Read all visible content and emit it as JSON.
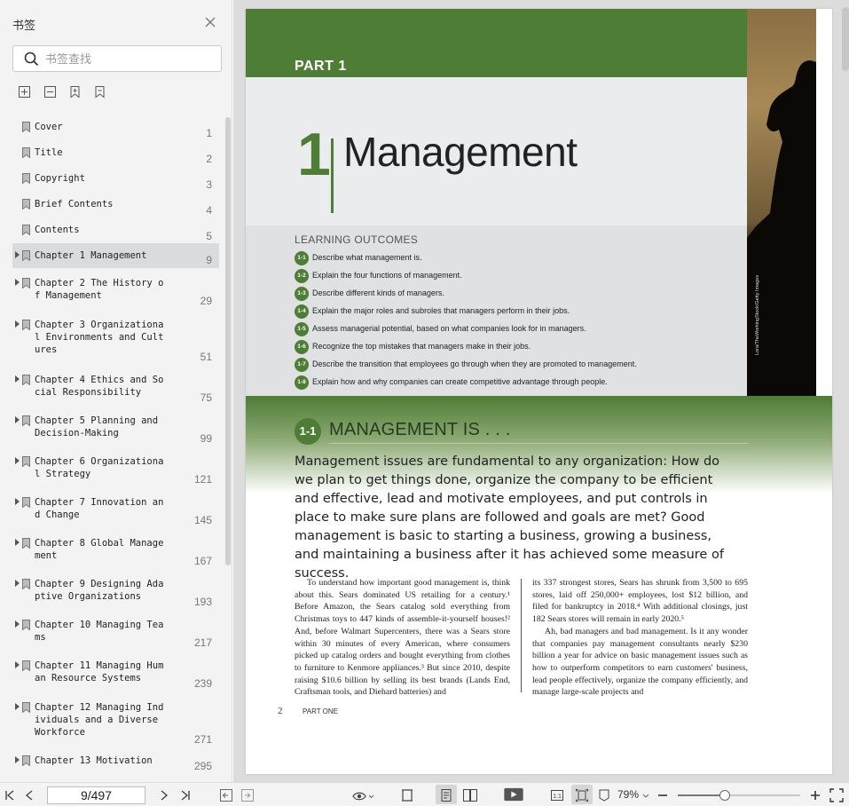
{
  "sidebar": {
    "title": "书签",
    "search_placeholder": "书签查找",
    "bookmarks": [
      {
        "label": "Cover",
        "page": "1",
        "expandable": false
      },
      {
        "label": "Title",
        "page": "2",
        "expandable": false
      },
      {
        "label": "Copyright",
        "page": "3",
        "expandable": false
      },
      {
        "label": "Brief Contents",
        "page": "4",
        "expandable": false
      },
      {
        "label": "Contents",
        "page": "5",
        "expandable": false
      },
      {
        "label": "Chapter 1 Management",
        "page": "9",
        "expandable": true,
        "active": true
      },
      {
        "label": "Chapter 2 The History of Management",
        "page": "29",
        "expandable": true
      },
      {
        "label": "Chapter 3 Organizational Environments and Cultures",
        "page": "51",
        "expandable": true
      },
      {
        "label": "Chapter 4 Ethics and Social Responsibility",
        "page": "75",
        "expandable": true
      },
      {
        "label": "Chapter 5 Planning and Decision-Making",
        "page": "99",
        "expandable": true
      },
      {
        "label": "Chapter 6 Organizational Strategy",
        "page": "121",
        "expandable": true
      },
      {
        "label": "Chapter 7 Innovation and Change",
        "page": "145",
        "expandable": true
      },
      {
        "label": "Chapter 8 Global Management",
        "page": "167",
        "expandable": true
      },
      {
        "label": "Chapter 9 Designing Adaptive Organizations",
        "page": "193",
        "expandable": true
      },
      {
        "label": "Chapter 10 Managing Teams",
        "page": "217",
        "expandable": true
      },
      {
        "label": "Chapter 11 Managing Human Resource Systems",
        "page": "239",
        "expandable": true
      },
      {
        "label": "Chapter 12 Managing Individuals and a Diverse Workforce",
        "page": "271",
        "expandable": true
      },
      {
        "label": "Chapter 13 Motivation",
        "page": "295",
        "expandable": true
      }
    ]
  },
  "page": {
    "part_label": "PART 1",
    "chapter_number": "1",
    "chapter_title": "Management",
    "photo_credit": "Lora/TheWorkingStock/Getty Images",
    "outcomes_heading": "LEARNING OUTCOMES",
    "outcomes": [
      {
        "id": "1-1",
        "text": "Describe what management is."
      },
      {
        "id": "1-2",
        "text": "Explain the four functions of management."
      },
      {
        "id": "1-3",
        "text": "Describe different kinds of managers."
      },
      {
        "id": "1-4",
        "text": "Explain the major roles and subroles that managers perform in their jobs."
      },
      {
        "id": "1-5",
        "text": "Assess managerial potential, based on what companies look for in managers."
      },
      {
        "id": "1-6",
        "text": "Recognize the top mistakes that managers make in their jobs."
      },
      {
        "id": "1-7",
        "text": "Describe the transition that employees go through when they are promoted to management."
      },
      {
        "id": "1-8",
        "text": "Explain how and why companies can create competitive advantage through people."
      }
    ],
    "section_number": "1-1",
    "section_title": "MANAGEMENT IS . . .",
    "intro": "Management issues are fundamental to any organization: How do we plan to get things done, organize the company to be efficient and effective, lead and motivate employees, and put controls in place to make sure plans are followed and goals are met? Good management is basic to starting a business, growing a business, and maintaining a business after it has achieved some measure of success.",
    "col_left": "To understand how important good management is, think about this. Sears dominated US retailing for a century.¹ Before Amazon, the Sears catalog sold everything from Christmas toys to 447 kinds of assemble-it-yourself houses!² And, before Walmart Supercenters, there was a Sears store within 30 minutes of every American, where consumers picked up catalog orders and bought everything from clothes to furniture to Kenmore appliances.³ But since 2010, despite raising $10.6 billion by selling its best brands (Lands End, Craftsman tools, and Diehard batteries) and",
    "col_right_1": "its 337 strongest stores, Sears has shrunk from 3,500 to 695 stores, laid off 250,000+ employees, lost $12 billion, and filed for bankruptcy in 2018.⁴ With additional closings, just 182 Sears stores will remain in early 2020.⁵",
    "col_right_2": "Ah, bad managers and bad management. Is it any wonder that companies pay management consultants nearly $230 billion a year for advice on basic management issues such as how to outperform competitors to earn customers' business, lead people effectively, organize the company efficiently, and manage large-scale projects and",
    "footer_page": "2",
    "footer_label": "PART ONE"
  },
  "bottombar": {
    "page_indicator": "9/497",
    "zoom": "79%"
  },
  "colors": {
    "brand_green": "#4e7d35",
    "sidebar_bg": "#f3f3f3",
    "viewer_bg": "#dcdcdc"
  }
}
